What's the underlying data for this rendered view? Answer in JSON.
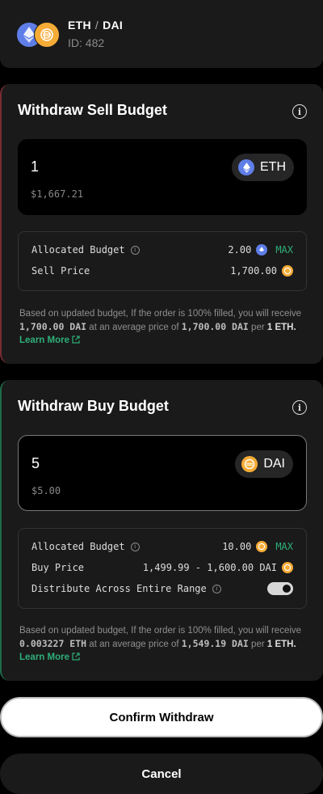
{
  "header": {
    "base": "ETH",
    "separator": "/",
    "quote": "DAI",
    "id_label": "ID: 482"
  },
  "sell": {
    "title": "Withdraw Sell Budget",
    "amount": "1",
    "amount_usd": "$1,667.21",
    "token": "ETH",
    "allocated_label": "Allocated Budget",
    "allocated_value": "2.00",
    "max_label": "MAX",
    "price_label": "Sell Price",
    "price_value": "1,700.00",
    "note_pre": "Based on updated budget, If the order is 100% filled, you will receive",
    "note_amount": "1,700.00 DAI",
    "note_mid": "at an average price of",
    "note_price": "1,700.00 DAI",
    "note_per": "per",
    "note_unit": "1 ETH.",
    "learn_more": "Learn More"
  },
  "buy": {
    "title": "Withdraw Buy Budget",
    "amount": "5",
    "amount_usd": "$5.00",
    "token": "DAI",
    "allocated_label": "Allocated Budget",
    "allocated_value": "10.00",
    "max_label": "MAX",
    "price_label": "Buy Price",
    "price_value": "1,499.99 - 1,600.00 DAI",
    "distribute_label": "Distribute Across Entire Range",
    "distribute_on": true,
    "note_pre": "Based on updated budget, If the order is 100% filled, you will receive",
    "note_amount": "0.003227 ETH",
    "note_mid": "at an average price of",
    "note_price": "1,549.19 DAI",
    "note_per": "per",
    "note_unit": "1 ETH.",
    "learn_more": "Learn More"
  },
  "actions": {
    "confirm": "Confirm Withdraw",
    "cancel": "Cancel"
  },
  "colors": {
    "eth": "#5f7ee8",
    "dai": "#f5ac37",
    "accent": "#2eaf79",
    "sell_border": "#7a2b32",
    "buy_border": "#1e6b4b"
  }
}
